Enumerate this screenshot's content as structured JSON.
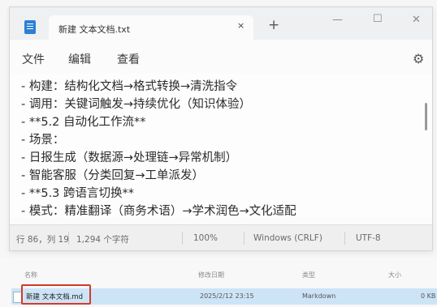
{
  "notepad": {
    "tab_title": "新建 文本文档.txt",
    "tab_close": "×",
    "new_tab": "+",
    "window_controls": {
      "minimize": "—",
      "maximize": "☐",
      "close": "✕"
    },
    "menu": {
      "file": "文件",
      "edit": "编辑",
      "view": "查看"
    },
    "settings_icon": "⚙",
    "lines": [
      "  - 构建：结构化文档→格式转换→清洗指令",
      "  - 调用：关键词触发→持续优化（知识体验）",
      "- **5.2 自动化工作流**",
      "  - 场景：",
      "    - 日报生成（数据源→处理链→异常机制）",
      "    - 智能客服（分类回复→工单派发）",
      "- **5.3 跨语言切换**",
      "  - 模式：精准翻译（商务术语）→学术润色→文化适配"
    ],
    "status": {
      "position": "行 86，列 19",
      "chars": "1,294 个字符",
      "zoom": "100%",
      "line_ending": "Windows (CRLF)",
      "encoding": "UTF-8"
    }
  },
  "explorer": {
    "columns": {
      "name": "名称",
      "date": "修改日期",
      "type": "类型",
      "size": "大小"
    },
    "file": {
      "name": "新建 文本文档.md",
      "date": "2025/2/12 23:15",
      "type": "Markdown",
      "size": "0 KB"
    }
  },
  "colors": {
    "highlight": "#d23a2a",
    "selection": "#cde4f7",
    "icon_blue": "#2d7fd6"
  }
}
